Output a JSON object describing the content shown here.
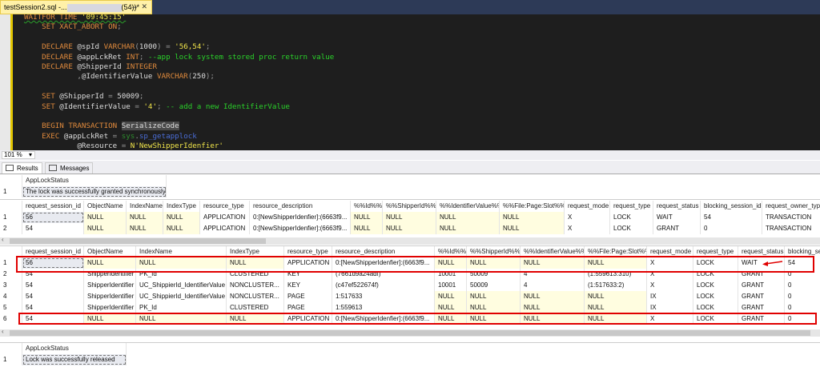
{
  "window": {
    "tab_title_prefix": "testSession2.sql -...",
    "tab_title_suffix": "(54))*",
    "pin": "⊸",
    "close": "✕"
  },
  "editor": {
    "lines": [
      [
        [
          "WAITFOR TIME ",
          "k wavy"
        ],
        [
          "'09:45:15'",
          "s wavy"
        ]
      ],
      [
        [
          "    SET XACT_ABORT ON",
          "k"
        ],
        [
          ";",
          "p"
        ]
      ],
      [],
      [
        [
          "    DECLARE ",
          "k"
        ],
        [
          "@spId ",
          "v"
        ],
        [
          "VARCHAR",
          "k"
        ],
        [
          "(",
          "p"
        ],
        [
          "1000",
          "v"
        ],
        [
          ") = ",
          "p"
        ],
        [
          "'56,54'",
          "s"
        ],
        [
          ";",
          "p"
        ]
      ],
      [
        [
          "    DECLARE ",
          "k"
        ],
        [
          "@appLckRet ",
          "v"
        ],
        [
          "INT",
          "k"
        ],
        [
          "; ",
          "p"
        ],
        [
          "--app lock system stored proc return value",
          "c"
        ]
      ],
      [
        [
          "    DECLARE ",
          "k"
        ],
        [
          "@ShipperId ",
          "v"
        ],
        [
          "INTEGER",
          "k"
        ]
      ],
      [
        [
          "            ,",
          "p"
        ],
        [
          "@IdentifierValue ",
          "v"
        ],
        [
          "VARCHAR",
          "k"
        ],
        [
          "(",
          "p"
        ],
        [
          "250",
          "v"
        ],
        [
          ");",
          "p"
        ]
      ],
      [],
      [
        [
          "    SET ",
          "k"
        ],
        [
          "@ShipperId ",
          "v"
        ],
        [
          "= ",
          "p"
        ],
        [
          "50009",
          "v"
        ],
        [
          ";",
          "p"
        ]
      ],
      [
        [
          "    SET ",
          "k"
        ],
        [
          "@IdentifierValue ",
          "v"
        ],
        [
          "= ",
          "p"
        ],
        [
          "'4'",
          "s"
        ],
        [
          "; ",
          "p"
        ],
        [
          "-- add a new IdentifierValue",
          "c"
        ]
      ],
      [],
      [
        [
          "    BEGIN TRANSACTION ",
          "k"
        ],
        [
          "SerializeCode",
          "v hl"
        ]
      ],
      [
        [
          "    EXEC ",
          "k"
        ],
        [
          "@appLckRet ",
          "v"
        ],
        [
          "= ",
          "p"
        ],
        [
          "sys",
          "sys"
        ],
        [
          ".",
          "p"
        ],
        [
          "sp_getapplock",
          "fn"
        ]
      ],
      [
        [
          "            @Resource ",
          "v"
        ],
        [
          "= ",
          "p"
        ],
        [
          "N'NewShipperIdenfier'",
          "s"
        ]
      ]
    ]
  },
  "zoom": {
    "level": "101 %"
  },
  "results_tabs": [
    {
      "label": "Results",
      "active": true
    },
    {
      "label": "Messages",
      "active": false
    }
  ],
  "grid1": {
    "columns": [
      "AppLockStatus"
    ],
    "rows": [
      [
        "1",
        "The lock was successfully granted synchronously"
      ]
    ]
  },
  "grid2": {
    "columns": [
      "request_session_id",
      "ObjectName",
      "IndexName",
      "IndexType",
      "resource_type",
      "resource_description",
      "%%Id%%",
      "%%ShipperId%%",
      "%%IdentifierValue%%",
      "%%File:Page:Slot%%",
      "request_mode",
      "request_type",
      "request_status",
      "blocking_session_id",
      "request_owner_type"
    ],
    "rows": [
      [
        "1",
        "56",
        "NULL",
        "NULL",
        "NULL",
        "APPLICATION",
        "0:[NewShipperIdenfier]:(6663f9...",
        "NULL",
        "NULL",
        "NULL",
        "NULL",
        "X",
        "LOCK",
        "WAIT",
        "54",
        "TRANSACTION"
      ],
      [
        "2",
        "54",
        "NULL",
        "NULL",
        "NULL",
        "APPLICATION",
        "0:[NewShipperIdenfier]:(6663f9...",
        "NULL",
        "NULL",
        "NULL",
        "NULL",
        "X",
        "LOCK",
        "GRANT",
        "0",
        "TRANSACTION"
      ]
    ]
  },
  "grid3": {
    "columns": [
      "request_session_id",
      "ObjectName",
      "IndexName",
      "IndexType",
      "resource_type",
      "resource_description",
      "%%Id%%",
      "%%ShipperId%%",
      "%%IdentifierValue%%",
      "%%File:Page:Slot%%",
      "request_mode",
      "request_type",
      "request_status",
      "blocking_session_id"
    ],
    "rows": [
      [
        "1",
        "56",
        "NULL",
        "NULL",
        "NULL",
        "APPLICATION",
        "0:[NewShipperIdenfier]:(6663f9...",
        "NULL",
        "NULL",
        "NULL",
        "NULL",
        "X",
        "LOCK",
        "WAIT",
        "54"
      ],
      [
        "2",
        "54",
        "ShipperIdentifier",
        "PK_Id",
        "CLUSTERED",
        "KEY",
        "(7661d9a24adf)",
        "10001",
        "50009",
        "4",
        "(1:559613:310)",
        "X",
        "LOCK",
        "GRANT",
        "0"
      ],
      [
        "3",
        "54",
        "ShipperIdentifier",
        "UC_ShippierId_IdentifierValue",
        "NONCLUSTER...",
        "KEY",
        "(c47ef522674f)",
        "10001",
        "50009",
        "4",
        "(1:517633:2)",
        "X",
        "LOCK",
        "GRANT",
        "0"
      ],
      [
        "4",
        "54",
        "ShipperIdentifier",
        "UC_ShippierId_IdentifierValue",
        "NONCLUSTER...",
        "PAGE",
        "1:517633",
        "NULL",
        "NULL",
        "NULL",
        "NULL",
        "IX",
        "LOCK",
        "GRANT",
        "0"
      ],
      [
        "5",
        "54",
        "ShipperIdentifier",
        "PK_Id",
        "CLUSTERED",
        "PAGE",
        "1:559613",
        "NULL",
        "NULL",
        "NULL",
        "NULL",
        "IX",
        "LOCK",
        "GRANT",
        "0"
      ],
      [
        "6",
        "54",
        "NULL",
        "NULL",
        "NULL",
        "APPLICATION",
        "0:[NewShipperIdenfier]:(6663f9...",
        "NULL",
        "NULL",
        "NULL",
        "NULL",
        "X",
        "LOCK",
        "GRANT",
        "0"
      ]
    ]
  },
  "grid4": {
    "columns": [
      "AppLockStatus"
    ],
    "rows": [
      [
        "1",
        "Lock was successfully released"
      ]
    ]
  },
  "annotation_color": "#e00000"
}
